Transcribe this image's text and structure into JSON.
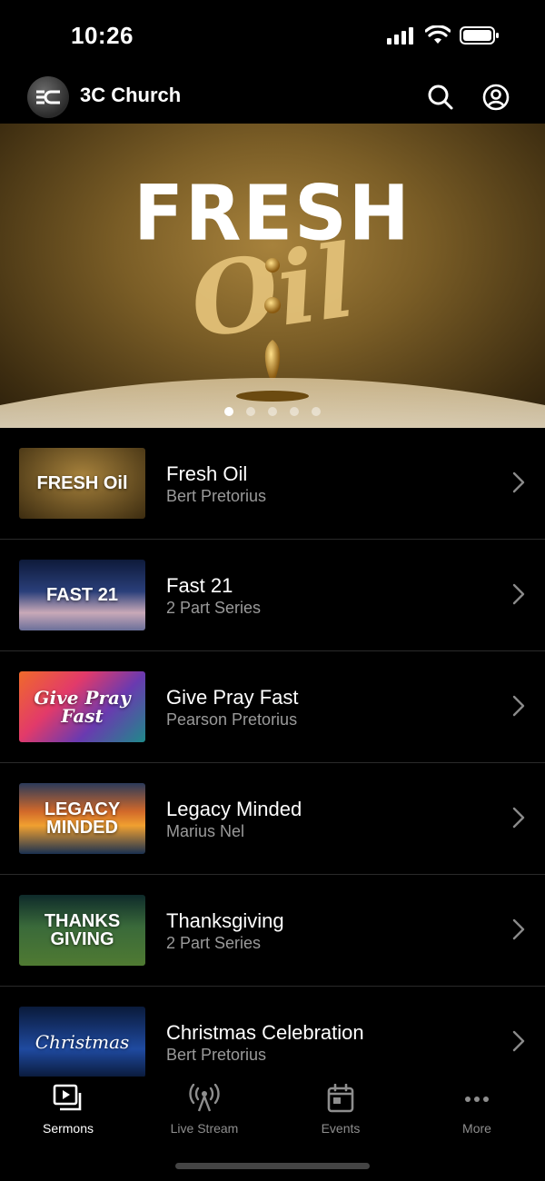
{
  "status": {
    "time": "10:26"
  },
  "header": {
    "title": "3C Church",
    "logo_text": "3C"
  },
  "hero": {
    "line1": "FRESH",
    "line2": "Oil",
    "active_slide": 0,
    "slide_count": 5
  },
  "sermons": [
    {
      "title": "Fresh Oil",
      "subtitle": "Bert Pretorius",
      "thumb_text": "FRESH Oil"
    },
    {
      "title": "Fast 21",
      "subtitle": "2 Part Series",
      "thumb_text": "FAST 21"
    },
    {
      "title": "Give Pray Fast",
      "subtitle": "Pearson Pretorius",
      "thumb_text": "Give Pray Fast"
    },
    {
      "title": "Legacy Minded",
      "subtitle": "Marius Nel",
      "thumb_text": "LEGACY MINDED"
    },
    {
      "title": "Thanksgiving",
      "subtitle": "2 Part Series",
      "thumb_text": "THANKS GIVING"
    },
    {
      "title": "Christmas Celebration",
      "subtitle": "Bert Pretorius",
      "thumb_text": "Christmas"
    }
  ],
  "tabs": [
    {
      "label": "Sermons",
      "icon": "play-square-icon",
      "active": true
    },
    {
      "label": "Live Stream",
      "icon": "broadcast-icon",
      "active": false
    },
    {
      "label": "Events",
      "icon": "calendar-icon",
      "active": false
    },
    {
      "label": "More",
      "icon": "more-icon",
      "active": false
    }
  ],
  "colors": {
    "active_tab": "#ffffff",
    "inactive_tab": "#8e8e8e",
    "subtitle": "#9a9a9a"
  }
}
